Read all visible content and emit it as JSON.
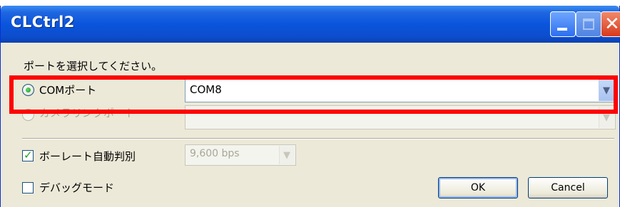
{
  "window": {
    "title": "CLCtrl2",
    "controls": {
      "minimize": "minimize-icon",
      "maximize": "maximize-icon",
      "close": "close-icon"
    }
  },
  "prompt": "ポートを選択してください。",
  "com_port": {
    "label": "COMポート",
    "selected": true,
    "combo_value": "COM8"
  },
  "camera_port": {
    "label": "カメラリンクポート",
    "selected": false,
    "disabled": true,
    "combo_value": ""
  },
  "baud_auto": {
    "label": "ボーレート自動判別",
    "checked": true,
    "combo_value": "9,600 bps"
  },
  "debug_mode": {
    "label": "デバッグモード",
    "checked": false
  },
  "buttons": {
    "ok": "OK",
    "cancel": "Cancel"
  },
  "colors": {
    "highlight": "#ff0000",
    "titlebar": "#0a55dd",
    "dialog_bg": "#ece9d8"
  }
}
